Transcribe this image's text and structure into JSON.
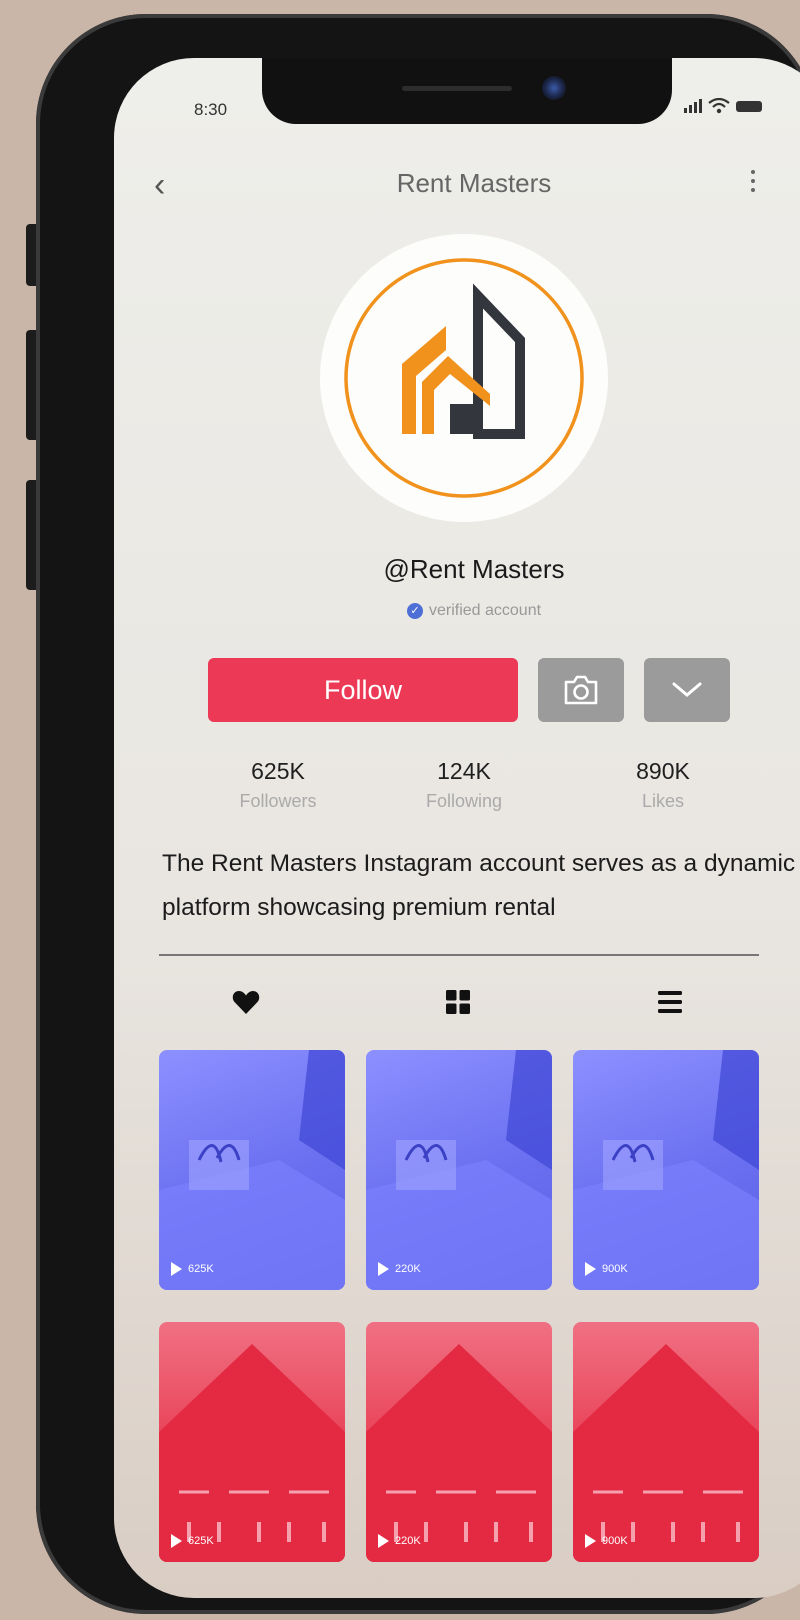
{
  "status_bar": {
    "time": "8:30"
  },
  "header": {
    "title": "Rent Masters"
  },
  "profile": {
    "handle": "@Rent Masters",
    "verified_label": "verified account",
    "follow_label": "Follow",
    "bio": "The Rent Masters Instagram account serves as a dynamic platform showcasing premium rental"
  },
  "stats": [
    {
      "value": "625K",
      "label": "Followers"
    },
    {
      "value": "124K",
      "label": "Following"
    },
    {
      "value": "890K",
      "label": "Likes"
    }
  ],
  "tabs": [
    {
      "icon": "heart-icon"
    },
    {
      "icon": "grid-icon"
    },
    {
      "icon": "list-icon"
    }
  ],
  "videos": [
    {
      "views": "625K",
      "theme": "blue"
    },
    {
      "views": "220K",
      "theme": "blue"
    },
    {
      "views": "900K",
      "theme": "blue"
    },
    {
      "views": "625K",
      "theme": "red"
    },
    {
      "views": "220K",
      "theme": "red"
    },
    {
      "views": "900K",
      "theme": "red"
    }
  ],
  "colors": {
    "accent": "#ec3a56",
    "logo_orange": "#f0921c",
    "logo_dark": "#33363d",
    "video_blue": "#6a6ff0",
    "video_red": "#e8394f"
  }
}
